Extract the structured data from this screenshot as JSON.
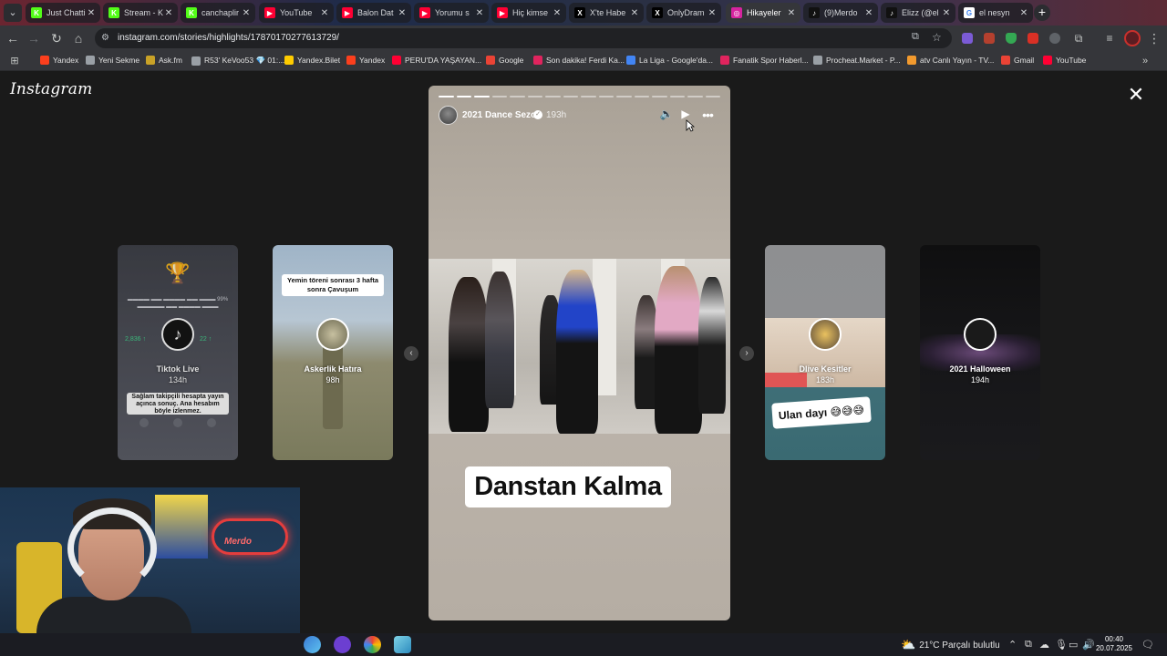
{
  "browser": {
    "tabs": [
      {
        "label": "Just Chatti",
        "fav_color": "#53fc18",
        "fav_char": "K"
      },
      {
        "label": "Stream - K",
        "fav_color": "#53fc18",
        "fav_char": "K"
      },
      {
        "label": "canchaplir",
        "fav_color": "#53fc18",
        "fav_char": "K"
      },
      {
        "label": "YouTube",
        "fav_color": "#ff0033",
        "fav_char": "▶"
      },
      {
        "label": "Balon Dat",
        "fav_color": "#ff0033",
        "fav_char": "▶"
      },
      {
        "label": "Yorumu s",
        "fav_color": "#ff0033",
        "fav_char": "▶"
      },
      {
        "label": "Hiç kimse",
        "fav_color": "#ff0033",
        "fav_char": "▶"
      },
      {
        "label": "X'te Habe",
        "fav_color": "#000000",
        "fav_char": "X"
      },
      {
        "label": "OnlyDram",
        "fav_color": "#000000",
        "fav_char": "X"
      },
      {
        "label": "Hikayeler",
        "fav_color": "#d6249f",
        "fav_char": "◎"
      },
      {
        "label": "(9)Merdo",
        "fav_color": "#111111",
        "fav_char": "♪"
      },
      {
        "label": "Elizz (@el",
        "fav_color": "#111111",
        "fav_char": "♪"
      },
      {
        "label": "el nesyn",
        "fav_color": "#ffffff",
        "fav_char": "G"
      }
    ],
    "active_tab_index": 9,
    "url": "instagram.com/stories/highlights/17870170277613729/",
    "bookmarks": [
      {
        "label": "Yandex",
        "color": "#fc3f1d"
      },
      {
        "label": "Yeni Sekme",
        "color": "#9aa0a6"
      },
      {
        "label": "Ask.fm",
        "color": "#c9a227"
      },
      {
        "label": "R53' KeVoo53 💎 01:...",
        "color": "#9aa0a6"
      },
      {
        "label": "Yandex.Bilet",
        "color": "#ffcc00"
      },
      {
        "label": "Yandex",
        "color": "#fc3f1d"
      },
      {
        "label": "PERU'DA YAŞAYAN...",
        "color": "#ff0033"
      },
      {
        "label": "Google",
        "color": "#ea4335"
      },
      {
        "label": "Son dakika! Ferdi Ka...",
        "color": "#e0245e"
      },
      {
        "label": "La Liga - Google'da...",
        "color": "#4285f4"
      },
      {
        "label": "Fanatik Spor Haberl...",
        "color": "#e0245e"
      },
      {
        "label": "Procheat.Market - P...",
        "color": "#9aa0a6"
      },
      {
        "label": "atv Canlı Yayın - TV...",
        "color": "#f29a2e"
      },
      {
        "label": "Gmail",
        "color": "#ea4335"
      },
      {
        "label": "YouTube",
        "color": "#ff0033"
      }
    ]
  },
  "instagram": {
    "logo": "Instagram",
    "story": {
      "username": "2021 Dance Sezon",
      "age": "193h",
      "caption": "Danstan Kalma",
      "segments_total": 16,
      "segments_done": 3
    },
    "side_highlights": [
      {
        "title": "Tiktok Live",
        "age": "134h",
        "top_text": "",
        "bottom_text": "Sağlam takipçili hesapta yayın açınca sonuç. Ana hesabım böyle izlenmez."
      },
      {
        "title": "Askerlik Hatıra",
        "age": "98h",
        "top_text": "Yemin töreni sonrası 3 hafta sonra Çavuşum",
        "bottom_text": ""
      },
      {
        "title": "Dlive Kesitler",
        "age": "183h",
        "top_text": "",
        "bottom_text": "Ulan dayı 😅😅😅"
      },
      {
        "title": "2021 Halloween",
        "age": "194h",
        "top_text": "",
        "bottom_text": ""
      }
    ]
  },
  "webcam": {
    "neon_sign": "Merdo"
  },
  "taskbar": {
    "weather": "21°C  Parçalı bulutlu",
    "time": "00:40",
    "date": "20.07.2025"
  }
}
